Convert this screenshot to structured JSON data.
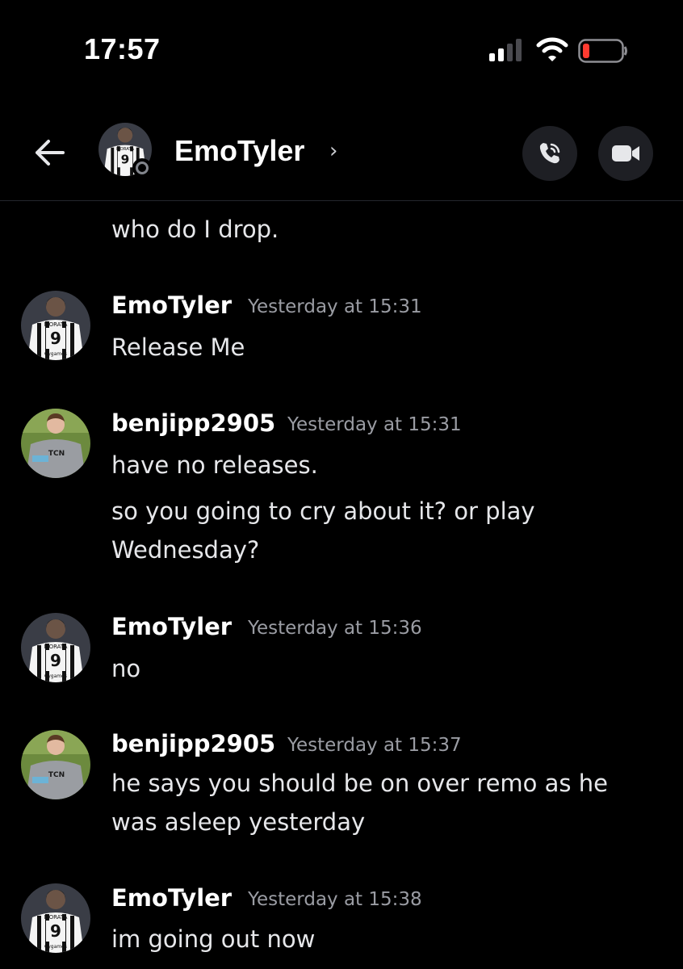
{
  "status_bar": {
    "time": "17:57"
  },
  "header": {
    "title": "EmoTyler",
    "chevron": "›"
  },
  "messages": [
    {
      "text": "who do I drop."
    },
    {
      "author": "EmoTyler",
      "timestamp": "Yesterday at 15:31",
      "text": "Release Me"
    },
    {
      "author": "benjipp2905",
      "timestamp": "Yesterday at 15:31",
      "text": "have no releases."
    },
    {
      "text_line1": "so you going to cry about it? or play",
      "text_line2": "Wednesday?"
    },
    {
      "author": "EmoTyler",
      "timestamp": "Yesterday at 15:36",
      "text": "no"
    },
    {
      "author": "benjipp2905",
      "timestamp": "Yesterday at 15:37",
      "text_line1": "he says you should be on over remo as he",
      "text_line2": "was asleep yesterday"
    },
    {
      "author": "EmoTyler",
      "timestamp": "Yesterday at 15:38",
      "text": "im going out now"
    }
  ],
  "avatars": {
    "emotyler_jersey_name": "MORATA",
    "emotyler_jersey_number": "9",
    "emotyler_sponsor": "Cygames",
    "benji_sponsor": "TCN"
  },
  "colors": {
    "background": "#000000",
    "header_button": "#1e1f24",
    "timestamp": "#9a9ca3",
    "battery_low": "#ff3b30"
  }
}
